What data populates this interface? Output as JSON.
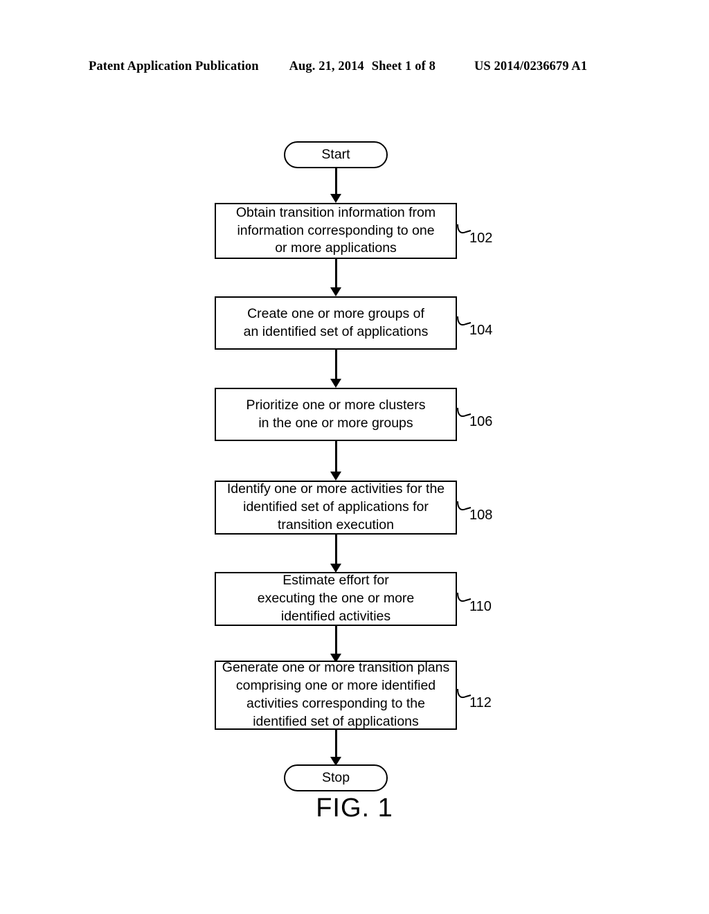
{
  "header": {
    "publication": "Patent Application Publication",
    "date": "Aug. 21, 2014",
    "sheet": "Sheet 1 of 8",
    "doc_number": "US 2014/0236679 A1"
  },
  "figure": {
    "caption": "FIG. 1",
    "ink_color": "#000000",
    "background_color": "#ffffff",
    "start": {
      "label": "Start",
      "shape": "terminator"
    },
    "stop": {
      "label": "Stop",
      "shape": "terminator"
    },
    "steps": [
      {
        "ref": "102",
        "text": "Obtain transition information from\ninformation corresponding to one\nor more applications"
      },
      {
        "ref": "104",
        "text": "Create one or more groups of\nan identified set of applications"
      },
      {
        "ref": "106",
        "text": "Prioritize one or more clusters\nin the one or more groups"
      },
      {
        "ref": "108",
        "text": "Identify one or more activities for the\nidentified set of applications for\ntransition execution"
      },
      {
        "ref": "110",
        "text": "Estimate effort for\nexecuting the one or more\nidentified activities"
      },
      {
        "ref": "112",
        "text": "Generate one or more transition plans\ncomprising one or more identified\nactivities corresponding to the\nidentified set of applications"
      }
    ]
  }
}
